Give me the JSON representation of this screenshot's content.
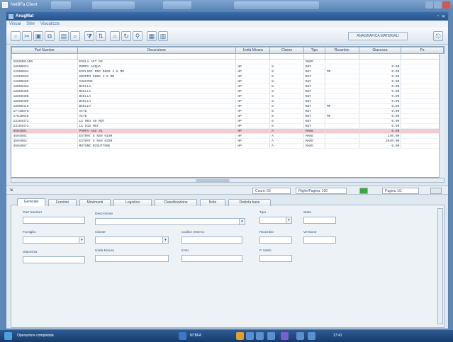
{
  "window_title": "NetBFa Client",
  "subwindow_title": "AnagMat",
  "menu": [
    "Visual",
    "Stile",
    "Visualizza"
  ],
  "toolbar": {
    "icons": [
      "new-doc-icon",
      "cut-icon",
      "save-icon",
      "copy-icon",
      "print-icon",
      "search-icon",
      "filter-icon",
      "sort-icon",
      "home-icon",
      "refresh-icon",
      "link-icon",
      "grid-icon",
      "close-icon"
    ],
    "anag_button": "ANAGRAFICA MATERIALI"
  },
  "grid": {
    "columns": [
      "Part Number",
      "Descrizione",
      "Unità Misura",
      "Classe",
      "Tipo",
      "Ricambio",
      "Giacenza",
      "Pz"
    ],
    "rows": [
      [
        "1550301106",
        "ESULA ACT 50",
        "",
        "",
        "MAKE",
        "",
        "",
        ""
      ],
      [
        "18500824",
        "POMPA ACQUA",
        "HP",
        "8",
        "BUY",
        "",
        "0.00",
        ""
      ],
      [
        "12850694",
        "ESPLOSI PER 0000 4-5 MR",
        "HP",
        "8",
        "BUY",
        "MP",
        "0.00",
        ""
      ],
      [
        "12850692",
        "GRUPPO 5005 4-5 MR",
        "HP",
        "8",
        "BUY",
        "",
        "0.00",
        ""
      ],
      [
        "12800205",
        "CUSCINI",
        "HP",
        "8",
        "BUY",
        "",
        "0.00",
        ""
      ],
      [
        "18850404",
        "BIELLA",
        "HP",
        "8",
        "BUY",
        "",
        "0.00",
        ""
      ],
      [
        "18850405",
        "BIELLA",
        "HP",
        "8",
        "BUY",
        "",
        "0.00",
        ""
      ],
      [
        "18850408",
        "BIELLA",
        "HP",
        "8",
        "BUY",
        "",
        "0.00",
        ""
      ],
      [
        "18850409",
        "BIELLA",
        "HP",
        "8",
        "BUY",
        "",
        "0.00",
        ""
      ],
      [
        "18850410",
        "BIELLA",
        "HP",
        "8",
        "BUY",
        "MP",
        "0.00",
        ""
      ],
      [
        "17715576",
        "VITE",
        "HP",
        "8",
        "BUY",
        "",
        "0.00",
        ""
      ],
      [
        "17810025",
        "VITE",
        "HP",
        "8",
        "BUY",
        "MP",
        "0.00",
        ""
      ],
      [
        "23104472",
        "LG 004 SH MOT",
        "HP",
        "8",
        "BUY",
        "",
        "0.00",
        ""
      ],
      [
        "23104473",
        "LG 015 MOT",
        "HP",
        "8",
        "BUY",
        "",
        "0.00",
        ""
      ],
      [
        "4504501",
        "POMPA AGG 01",
        "HP",
        "A",
        "MAKE",
        "",
        "0.00",
        ""
      ],
      [
        "4504502",
        "ESTRAT 5 NSH 0100",
        "HP",
        "A",
        "MAKE",
        "",
        "140.00",
        ""
      ],
      [
        "4504503",
        "ESTRAT 5 NSH 0200",
        "HP",
        "A",
        "MAKE",
        "",
        "2640.00",
        ""
      ],
      [
        "4504507",
        "MOTORE RIDUTTORE",
        "HP",
        "A",
        "MAKE",
        "",
        "0.00",
        ""
      ]
    ],
    "selected_row": 14
  },
  "status": {
    "count": "Count: 63",
    "page": "Righe/Pagina: 100",
    "page_num": "Pagina 1/1"
  },
  "tabs": [
    "Generale",
    "Fornitori",
    "Movimenti",
    "Logistica",
    "Classificazione",
    "Note",
    "Distinta base"
  ],
  "form": {
    "part_number": "Part Number",
    "descrizione": "Descrizione",
    "tipo": "Tipo",
    "stato": "Stato",
    "famiglia": "Famiglia",
    "classe": "Classe",
    "codice_esterno": "Codice esterno",
    "ricambio": "Ricambio",
    "versione": "Versione",
    "giacenza": "Giacenza",
    "unita_misura": "Unità Misura",
    "ean": "EAN",
    "peso": "P. Netto"
  },
  "taskbar": {
    "start": "Operazione completata",
    "app": "NTBFA",
    "clock": "17:41"
  }
}
